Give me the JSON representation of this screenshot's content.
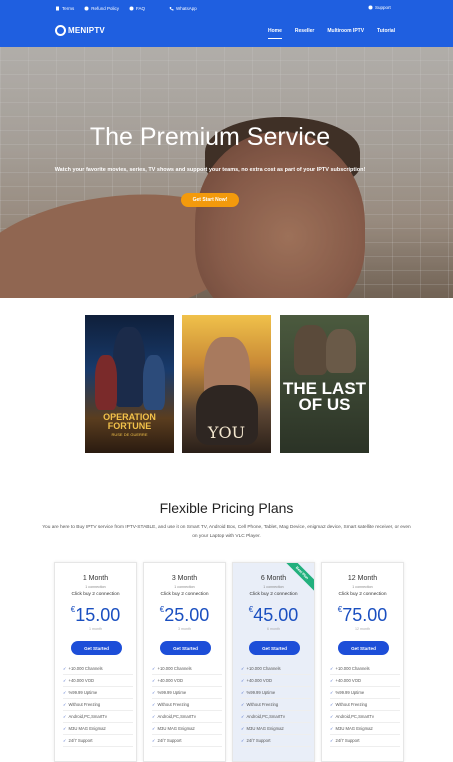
{
  "topbar": {
    "terms": "Terms",
    "refund": "Refund Policy",
    "faq": "FAQ",
    "whatsapp": "WhatsApp",
    "support": "Support"
  },
  "nav": {
    "logo": "MENIPTV",
    "items": [
      "Home",
      "Reseller",
      "Multiroom IPTV",
      "Tutorial"
    ]
  },
  "hero": {
    "title": "The Premium Service",
    "subtitle": "Watch your favorite movies, series, TV shows and support your teams, no extra cost as part of your IPTV subscription!",
    "cta": "Get Start Now!"
  },
  "posters": {
    "p1_title": "OPERATION FORTUNE",
    "p1_sub": "RUSE DE GUERRE",
    "p2_title": "YOU",
    "p3_title": "THE LAST OF US"
  },
  "pricing": {
    "title": "Flexible Pricing Plans",
    "description": "You are here to Buy IPTV service from IPTV-STABLE, and use it on Smart TV, Android Box, Cell Phone, Tablet, Mag Device, enigma2 device, Smart satellite receiver, or even on your Laptop with VLC Player.",
    "button": "Get Started",
    "buy_note": "Click buy 2 connection",
    "features": [
      "+10.000 Channels",
      "+40.000 VOD",
      "%99.99 Uptime",
      "Without Freezing",
      "Android,PC,SmartTv",
      "M3U MAG Enigma2",
      "24/7 Support"
    ],
    "plans": [
      {
        "name": "1 Month",
        "connection": "1 connection",
        "price": "15.00",
        "currency": "€",
        "period": "1 month"
      },
      {
        "name": "3 Month",
        "connection": "1 connection",
        "price": "25.00",
        "currency": "€",
        "period": "3 month"
      },
      {
        "name": "6 Month",
        "connection": "1 connection",
        "price": "45.00",
        "currency": "€",
        "period": "6 month",
        "ribbon": "Best Plan"
      },
      {
        "name": "12 Month",
        "connection": "1 connection",
        "price": "75.00",
        "currency": "€",
        "period": "12 month"
      }
    ]
  },
  "colors": {
    "brand_blue": "#1f5fe0",
    "cta_orange": "#f39a0c",
    "price_blue": "#1a4fc0",
    "ribbon_green": "#22b07d"
  }
}
